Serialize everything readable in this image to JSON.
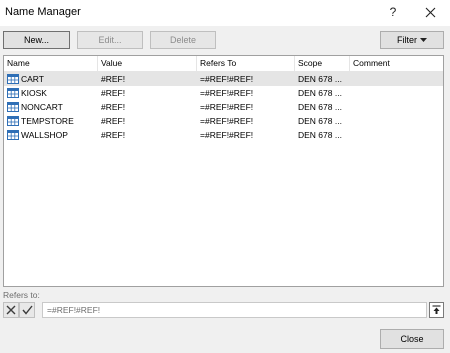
{
  "window": {
    "title": "Name Manager",
    "help_label": "?"
  },
  "toolbar": {
    "new_label": "New...",
    "edit_label": "Edit...",
    "delete_label": "Delete",
    "filter_label": "Filter"
  },
  "table": {
    "columns": [
      "Name",
      "Value",
      "Refers To",
      "Scope",
      "Comment"
    ],
    "rows": [
      {
        "name": "CART",
        "value": "#REF!",
        "refers_to": "=#REF!#REF!",
        "scope": "DEN 678 ...",
        "comment": ""
      },
      {
        "name": "KIOSK",
        "value": "#REF!",
        "refers_to": "=#REF!#REF!",
        "scope": "DEN 678 ...",
        "comment": ""
      },
      {
        "name": "NONCART",
        "value": "#REF!",
        "refers_to": "=#REF!#REF!",
        "scope": "DEN 678 ...",
        "comment": ""
      },
      {
        "name": "TEMPSTORE",
        "value": "#REF!",
        "refers_to": "=#REF!#REF!",
        "scope": "DEN 678 ...",
        "comment": ""
      },
      {
        "name": "WALLSHOP",
        "value": "#REF!",
        "refers_to": "=#REF!#REF!",
        "scope": "DEN 678 ...",
        "comment": ""
      }
    ],
    "selected_row": 0
  },
  "refers_to": {
    "label": "Refers to:",
    "value": "=#REF!#REF!"
  },
  "footer": {
    "close_label": "Close"
  },
  "colors": {
    "selected_row": "#e5e5e5",
    "icon_blue": "#2f6fb6"
  },
  "icons": {
    "help": "question-mark",
    "close": "x-close",
    "row": "table-name-icon",
    "filter_dropdown": "caret-down",
    "cancel": "x-mark",
    "confirm": "check-mark",
    "collapse": "arrow-up-collapse"
  }
}
